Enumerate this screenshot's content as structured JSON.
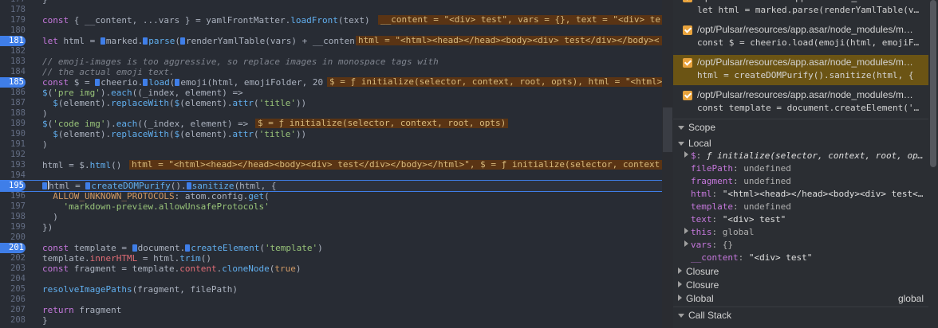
{
  "editor": {
    "lines": [
      {
        "n": "177",
        "segs": [
          [
            "p",
            "}"
          ]
        ]
      },
      {
        "n": "178",
        "segs": []
      },
      {
        "n": "179",
        "segs": [
          [
            "kw",
            "const"
          ],
          [
            "p",
            " { __content, ...vars } = yamlFrontMatter."
          ],
          [
            "fn",
            "loadFront"
          ],
          [
            "p",
            "(text)"
          ]
        ],
        "val": "__content = \"<div> test\", vars = {}, text = \"<div> te",
        "valx": 474
      },
      {
        "n": "180",
        "segs": []
      },
      {
        "n": "181",
        "bp": true,
        "segs": [
          [
            "kw",
            "let"
          ],
          [
            "p",
            " html = "
          ],
          [
            "bm",
            ""
          ],
          [
            "p",
            "marked."
          ],
          [
            "bm",
            ""
          ],
          [
            "fn",
            "parse"
          ],
          [
            "p",
            "("
          ],
          [
            "bm",
            ""
          ],
          [
            "p",
            "renderYamlTable(vars) + __conten"
          ]
        ],
        "val": "html = \"<html><head></head><body><div> test</div></body><",
        "valx": 446
      },
      {
        "n": "182",
        "segs": []
      },
      {
        "n": "183",
        "segs": [
          [
            "cm",
            "// emoji-images is too aggressive, so replace images in monospace tags with"
          ]
        ]
      },
      {
        "n": "184",
        "segs": [
          [
            "cm",
            "// the actual emoji text."
          ]
        ]
      },
      {
        "n": "185",
        "bp": true,
        "segs": [
          [
            "kw",
            "const"
          ],
          [
            "p",
            " $ = "
          ],
          [
            "bm",
            ""
          ],
          [
            "p",
            "cheerio."
          ],
          [
            "bm",
            ""
          ],
          [
            "fn",
            "load"
          ],
          [
            "p",
            "("
          ],
          [
            "bm",
            ""
          ],
          [
            "p",
            "emoji(html, emojiFolder, 20"
          ]
        ],
        "val": "$ = ƒ initialize(selector, context, root, opts), html = \"<html>",
        "valx": 410
      },
      {
        "n": "186",
        "segs": [
          [
            "fn",
            "$"
          ],
          [
            "p",
            "("
          ],
          [
            "str",
            "'pre img'"
          ],
          [
            "p",
            ")."
          ],
          [
            "fn",
            "each"
          ],
          [
            "p",
            "((_index, element) =>"
          ]
        ]
      },
      {
        "n": "187",
        "segs": [
          [
            "p",
            "  "
          ],
          [
            "fn",
            "$"
          ],
          [
            "p",
            "(element)."
          ],
          [
            "fn",
            "replaceWith"
          ],
          [
            "p",
            "("
          ],
          [
            "fn",
            "$"
          ],
          [
            "p",
            "(element)."
          ],
          [
            "fn",
            "attr"
          ],
          [
            "p",
            "("
          ],
          [
            "str",
            "'title'"
          ],
          [
            "p",
            "))"
          ]
        ]
      },
      {
        "n": "188",
        "segs": [
          [
            "p",
            ")"
          ]
        ]
      },
      {
        "n": "189",
        "segs": [
          [
            "fn",
            "$"
          ],
          [
            "p",
            "("
          ],
          [
            "str",
            "'code img'"
          ],
          [
            "p",
            ")."
          ],
          [
            "fn",
            "each"
          ],
          [
            "p",
            "((_index, element) =>"
          ]
        ],
        "val": "$ = ƒ initialize(selector, context, root, opts)",
        "valx": 320
      },
      {
        "n": "190",
        "segs": [
          [
            "p",
            "  "
          ],
          [
            "fn",
            "$"
          ],
          [
            "p",
            "(element)."
          ],
          [
            "fn",
            "replaceWith"
          ],
          [
            "p",
            "("
          ],
          [
            "fn",
            "$"
          ],
          [
            "p",
            "(element)."
          ],
          [
            "fn",
            "attr"
          ],
          [
            "p",
            "("
          ],
          [
            "str",
            "'title'"
          ],
          [
            "p",
            "))"
          ]
        ]
      },
      {
        "n": "191",
        "segs": [
          [
            "p",
            ")"
          ]
        ]
      },
      {
        "n": "192",
        "segs": []
      },
      {
        "n": "193",
        "segs": [
          [
            "p",
            "html = $."
          ],
          [
            "fn",
            "html"
          ],
          [
            "p",
            "()"
          ]
        ],
        "val": "html = \"<html><head></head><body><div> test</div></body></html>\", $ = ƒ initialize(selector, context",
        "valx": 162
      },
      {
        "n": "194",
        "segs": []
      },
      {
        "n": "195",
        "bp": true,
        "cur": true,
        "segs": [
          [
            "bm",
            ""
          ],
          [
            "cur",
            ""
          ],
          [
            "p",
            "html = "
          ],
          [
            "bm",
            ""
          ],
          [
            "fn",
            "createDOMPurify"
          ],
          [
            "p",
            "()."
          ],
          [
            "bm",
            ""
          ],
          [
            "fn",
            "sanitize"
          ],
          [
            "p",
            "(html, {"
          ]
        ]
      },
      {
        "n": "196",
        "segs": [
          [
            "p",
            "  "
          ],
          [
            "const",
            "ALLOW_UNKNOWN_PROTOCOLS"
          ],
          [
            "p",
            ": atom.config."
          ],
          [
            "fn",
            "get"
          ],
          [
            "p",
            "("
          ]
        ]
      },
      {
        "n": "197",
        "segs": [
          [
            "p",
            "    "
          ],
          [
            "str",
            "'markdown-preview.allowUnsafeProtocols'"
          ]
        ]
      },
      {
        "n": "198",
        "segs": [
          [
            "p",
            "  )"
          ]
        ]
      },
      {
        "n": "199",
        "segs": [
          [
            "p",
            "})"
          ]
        ]
      },
      {
        "n": "200",
        "segs": []
      },
      {
        "n": "201",
        "bp": true,
        "segs": [
          [
            "kw",
            "const"
          ],
          [
            "p",
            " template = "
          ],
          [
            "bm",
            ""
          ],
          [
            "p",
            "document."
          ],
          [
            "bm",
            ""
          ],
          [
            "fn",
            "createElement"
          ],
          [
            "p",
            "("
          ],
          [
            "str",
            "'template'"
          ],
          [
            "p",
            ")"
          ]
        ]
      },
      {
        "n": "202",
        "segs": [
          [
            "p",
            "template."
          ],
          [
            "prop",
            "innerHTML"
          ],
          [
            "p",
            " = html."
          ],
          [
            "fn",
            "trim"
          ],
          [
            "p",
            "()"
          ]
        ]
      },
      {
        "n": "203",
        "segs": [
          [
            "kw",
            "const"
          ],
          [
            "p",
            " fragment = template."
          ],
          [
            "prop",
            "content"
          ],
          [
            "p",
            "."
          ],
          [
            "fn",
            "cloneNode"
          ],
          [
            "p",
            "("
          ],
          [
            "num",
            "true"
          ],
          [
            "p",
            ")"
          ]
        ]
      },
      {
        "n": "204",
        "segs": []
      },
      {
        "n": "205",
        "segs": [
          [
            "fn",
            "resolveImagePaths"
          ],
          [
            "p",
            "(fragment, filePath)"
          ]
        ]
      },
      {
        "n": "206",
        "segs": []
      },
      {
        "n": "207",
        "segs": [
          [
            "kw",
            "return"
          ],
          [
            "p",
            " fragment"
          ]
        ]
      },
      {
        "n": "208",
        "segs": [
          [
            "p",
            "}"
          ]
        ]
      }
    ]
  },
  "breakpoints": [
    {
      "path": "/opt/Pulsar/resources/app.asar/node_modules/m…",
      "code": "let html = marked.parse(renderYamlTable(v…",
      "highlighted": false
    },
    {
      "path": "/opt/Pulsar/resources/app.asar/node_modules/m…",
      "code": "const $ = cheerio.load(emoji(html, emojiF…",
      "highlighted": false
    },
    {
      "path": "/opt/Pulsar/resources/app.asar/node_modules/m…",
      "code": "html = createDOMPurify().sanitize(html, {",
      "highlighted": true
    },
    {
      "path": "/opt/Pulsar/resources/app.asar/node_modules/m…",
      "code": "const template = document.createElement('…",
      "highlighted": false
    }
  ],
  "scope": {
    "title": "Scope",
    "local_label": "Local",
    "vars": [
      {
        "tri": true,
        "name": "$",
        "value": "ƒ initialize(selector, context, root, op…",
        "italic": true
      },
      {
        "tri": false,
        "name": "filePath",
        "value": "undefined"
      },
      {
        "tri": false,
        "name": "fragment",
        "value": "undefined"
      },
      {
        "tri": false,
        "name": "html",
        "value": "\"<html><head></head><body><div> test<…"
      },
      {
        "tri": false,
        "name": "template",
        "value": "undefined"
      },
      {
        "tri": false,
        "name": "text",
        "value": "\"<div> test\""
      },
      {
        "tri": true,
        "name": "this",
        "value": "global"
      },
      {
        "tri": true,
        "name": "vars",
        "value": "{}"
      },
      {
        "tri": false,
        "name": "__content",
        "value": "\"<div> test\""
      }
    ],
    "closure1": "Closure",
    "closure2": "Closure",
    "global_label": "Global",
    "global_value": "global"
  },
  "callstack": {
    "title": "Call Stack"
  },
  "colors": {
    "accent": "#3f7ee8",
    "checkbox": "#e8a33d",
    "highlight": "#6b5414",
    "value_bg": "#5a3414"
  }
}
